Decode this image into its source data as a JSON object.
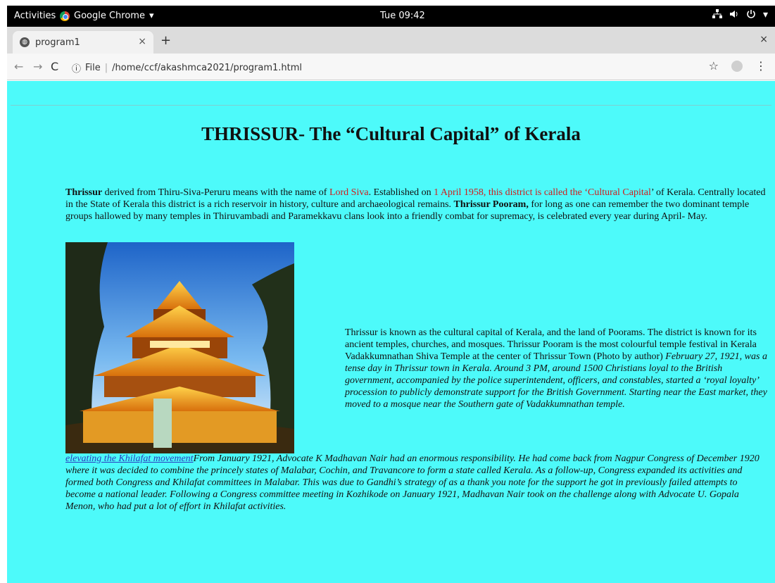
{
  "topbar": {
    "activities": "Activities",
    "app_name": "Google Chrome",
    "app_caret": "▾",
    "clock": "Tue 09:42",
    "icons": [
      "network-icon",
      "volume-icon",
      "power-icon",
      "caret-down-icon"
    ]
  },
  "browser": {
    "tab_title": "program1",
    "tab_close": "×",
    "new_tab": "+",
    "window_close": "×",
    "back": "←",
    "forward": "→",
    "reload": "C",
    "info": "ⓘ",
    "url_scheme": "File",
    "url_sep": "|",
    "url_path": "/home/ccf/akashmca2021/program1.html",
    "star": "☆",
    "menu": "⋮"
  },
  "content": {
    "title": "THRISSUR- The “Cultural Capital” of Kerala",
    "p1": {
      "b1": "Thrissur",
      "t1": " derived from Thiru-Siva-Peruru means with the name of ",
      "r1": "Lord Siva",
      "t2": ". Established on ",
      "r2": "1 April 1958, this district is called the ‘Cultural Capital",
      "t3": "’ of Kerala. Centrally located in the State of Kerala this district is a rich reservoir in history, culture and archaeological remains. ",
      "b2": "Thrissur Pooram,",
      "t4": " for long as one can remember the two dominant temple groups hallowed by many temples in Thiruvambadi and Paramekkavu clans look into a friendly combat for supremacy, is celebrated every year during April- May."
    },
    "p2": {
      "normal": "Thrissur is known as the cultural capital of Kerala, and the land of Poorams. The district is known for its ancient temples, churches, and mosques. Thrissur Pooram is the most colourful temple festival in Kerala Vadakkumnathan Shiva Temple at the center of Thrissur Town (Photo by author) ",
      "italic": "February 27, 1921, was a tense day in Thrissur town in Kerala. Around 3 PM, around 1500 Christians loyal to the British government, accompanied by the police superintendent, officers, and constables, started a ‘royal loyalty’ procession to publicly demonstrate support for the British Government. Starting near the East market, they moved to a mosque near the Southern gate of Vadakkumnathan temple."
    },
    "p3": {
      "link": "elevating the Khilafat movement",
      "text": "From January 1921, Advocate K Madhavan Nair had an enormous responsibility. He had come back from Nagpur Congress of December 1920 where it was decided to combine the princely states of Malabar, Cochin, and Travancore to form a state called Kerala. As a follow-up, Congress expanded its activities and formed both Congress and Khilafat committees in Malabar. This was due to Gandhi’s strategy of as a thank you note for the support he got in previously failed attempts to become a national leader. Following a Congress committee meeting in Kozhikode on January 1921, Madhavan Nair took on the challenge along with Advocate U. Gopala Menon, who had put a lot of effort in Khilafat activities."
    },
    "colors": {
      "page_bg": "#4dfafa",
      "red_text": "#d01c1c",
      "link": "#2a3ec0"
    }
  }
}
